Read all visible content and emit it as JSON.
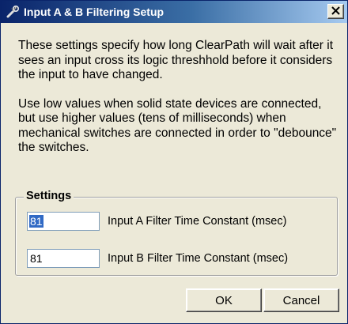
{
  "window": {
    "title": "Input A & B Filtering Setup",
    "icon": "wrench-icon",
    "close_glyph": "✕"
  },
  "description": {
    "paragraph1": "These settings specify how long ClearPath will wait after it sees an input cross its logic threshhold before it considers the input to have changed.",
    "paragraph2": "Use low values when solid state devices are connected, but use higher values (tens of milliseconds) when mechanical switches are connected in order to \"debounce\" the switches."
  },
  "settings": {
    "legend": "Settings",
    "input_a": {
      "value": "81",
      "label": "Input A Filter Time Constant (msec)"
    },
    "input_b": {
      "value": "81",
      "label": "Input B Filter Time Constant (msec)"
    }
  },
  "buttons": {
    "ok": "OK",
    "cancel": "Cancel"
  },
  "colors": {
    "titlebar_start": "#0A246A",
    "titlebar_end": "#A6CAF0",
    "dialog_bg": "#ECE9D8",
    "selection": "#316AC5"
  }
}
